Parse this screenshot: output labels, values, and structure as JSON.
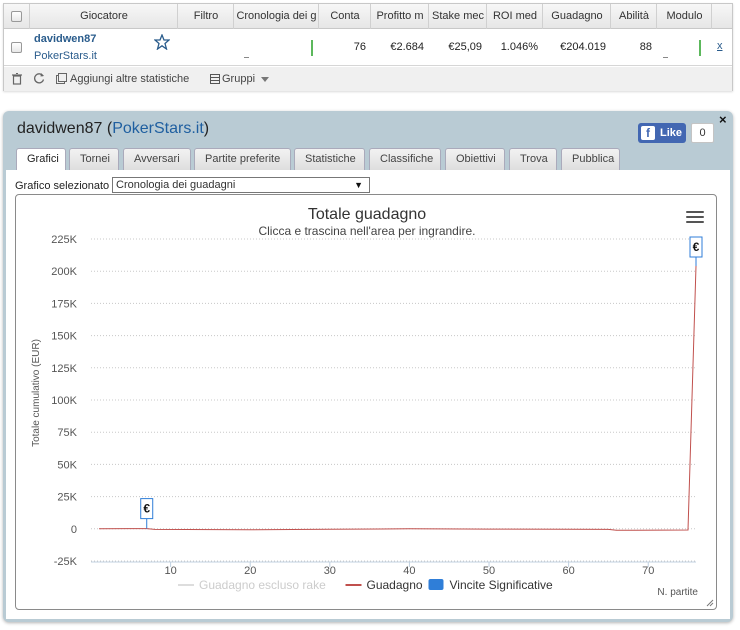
{
  "grid": {
    "headers": {
      "player": "Giocatore",
      "filter": "Filtro",
      "history": "Cronologia dei g",
      "count": "Conta",
      "avg_profit": "Profitto m",
      "avg_stake": "Stake mec",
      "avg_roi": "ROI med",
      "winnings": "Guadagno",
      "ability": "Abilità",
      "form": "Modulo"
    },
    "row": {
      "player_name": "davidwen87",
      "site": "PokerStars.it",
      "count": "76",
      "avg_profit": "€2.684",
      "avg_stake": "€25,09",
      "avg_roi": "1.046%",
      "winnings": "€204.019",
      "ability": "88",
      "remove": "x"
    },
    "toolbar": {
      "add_stats": "Aggiungi altre statistiche",
      "groups": "Gruppi"
    }
  },
  "panel": {
    "player_name": "davidwen87",
    "site": "PokerStars.it",
    "open_paren": "(",
    "close_paren": ")",
    "close_label": "×",
    "fb_like": "Like",
    "fb_count": "0",
    "tabs": [
      "Grafici",
      "Tornei",
      "Avversari",
      "Partite preferite",
      "Statistiche",
      "Classifiche",
      "Obiettivi",
      "Trova",
      "Pubblica"
    ],
    "selector_label": "Grafico selezionato",
    "selector_value": "Cronologia dei guadagni",
    "selector_arrow": "▼"
  },
  "chart_data": {
    "type": "line",
    "title": "Totale guadagno",
    "subtitle": "Clicca e trascina nell'area per ingrandire.",
    "ylabel": "Totale cumulativo (EUR)",
    "xlabel": "N. partite",
    "ylim": [
      -25000,
      225000
    ],
    "xlim": [
      0,
      76
    ],
    "y_ticks": [
      -25000,
      0,
      25000,
      50000,
      75000,
      100000,
      125000,
      150000,
      175000,
      200000,
      225000
    ],
    "y_tick_labels": [
      "-25K",
      "0",
      "25K",
      "50K",
      "75K",
      "100K",
      "125K",
      "150K",
      "175K",
      "200K",
      "225K"
    ],
    "x_ticks": [
      10,
      20,
      30,
      40,
      50,
      60,
      70
    ],
    "x_tick_labels": [
      "10",
      "20",
      "30",
      "40",
      "50",
      "60",
      "70"
    ],
    "grid": "horizontal dotted",
    "legend_position": "bottom",
    "series": [
      {
        "name": "Guadagno escluso rake",
        "color": "#dddddd",
        "points": []
      },
      {
        "name": "Guadagno",
        "color": "#c0504d",
        "points": [
          [
            1,
            0
          ],
          [
            7,
            150
          ],
          [
            8,
            -500
          ],
          [
            20,
            -800
          ],
          [
            30,
            -300
          ],
          [
            40,
            0
          ],
          [
            50,
            -200
          ],
          [
            60,
            -400
          ],
          [
            65,
            -500
          ],
          [
            66,
            -1200
          ],
          [
            75,
            -900
          ],
          [
            76,
            204019
          ]
        ]
      }
    ],
    "significant_wins": {
      "name": "Vincite Significative",
      "color": "#2f7ed8",
      "flag_symbol": "€",
      "points": [
        [
          7,
          150
        ],
        [
          76,
          204019
        ]
      ]
    }
  }
}
